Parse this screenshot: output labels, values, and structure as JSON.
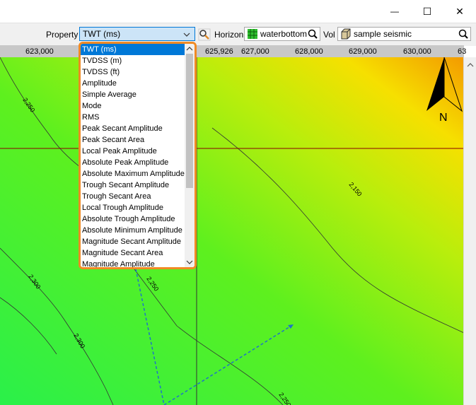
{
  "window": {
    "minimize_glyph": "—",
    "maximize_glyph": "☐",
    "close_glyph": "✕"
  },
  "toolbar": {
    "property_label": "Property",
    "property_value": "TWT (ms)",
    "horizon_label": "Horizon",
    "horizon_value": "waterbottom",
    "vol_label": "Vol",
    "vol_value": "sample seismic"
  },
  "ruler": {
    "ticks": [
      "623,000",
      "625,926",
      "627,000",
      "628,000",
      "629,000",
      "630,000",
      "63"
    ]
  },
  "map": {
    "contour_labels": [
      "2,250",
      "2,150",
      "2,300",
      "2,250",
      "2,300",
      "2,250"
    ],
    "north_label": "N",
    "colors": {
      "green": "#3ef53e",
      "lime": "#8ef21a",
      "yellow": "#f6e600",
      "orange": "#f39a00",
      "cursor": "#8b0000",
      "well_path": "#1e73c8"
    }
  },
  "property_dropdown": {
    "selected": "TWT (ms)",
    "items": [
      "TWT (ms)",
      "TVDSS (m)",
      "TVDSS (ft)",
      "Amplitude",
      "Simple Average",
      "Mode",
      "RMS",
      "Peak Secant Amplitude",
      "Peak Secant Area",
      "Local Peak Amplitude",
      "Absolute Peak Amplitude",
      "Absolute Maximum Amplitude",
      "Trough Secant Amplitude",
      "Trough Secant Area",
      "Local Trough Amplitude",
      "Absolute Trough Amplitude",
      "Absolute Minimum Amplitude",
      "Magnitude Secant Amplitude",
      "Magnitude Secant Area",
      "Magnitude Amplitude"
    ]
  }
}
